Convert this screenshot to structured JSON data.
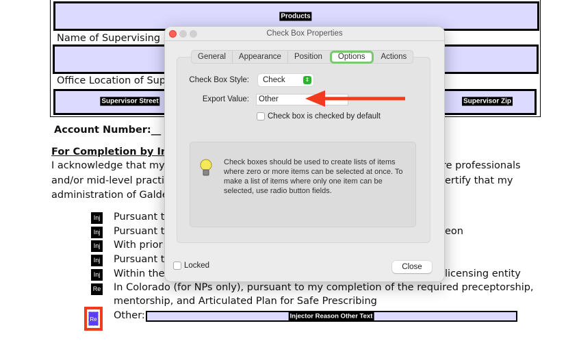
{
  "document": {
    "fields": {
      "products": "Products",
      "supervisor_street": "Supervisor Street",
      "supervisor_zip": "Supervisor Zip",
      "other_text": "Injector Reason Other Text"
    },
    "labels": {
      "supervising_name": "Name of Supervising He",
      "office_location": "Office Location of Supe",
      "account_number": "Account Number:__",
      "section_heading": "For Completion by Injec"
    },
    "paragraph": {
      "line1_left": "I acknowledge that my s",
      "line1_right": "re professionals",
      "line2_left": "and/or mid-level practit",
      "line2_right": "ertify that my",
      "line3_left": "administration of Galder"
    },
    "list": [
      {
        "icon": "Inj",
        "text": "Pursuant to",
        "right": ""
      },
      {
        "icon": "Inj",
        "text": "Pursuant to",
        "right": "eon"
      },
      {
        "icon": "Inj",
        "text": "With prior",
        "right": ""
      },
      {
        "icon": "Inj",
        "text": "Pursuant to",
        "right": ""
      },
      {
        "icon": "Inj",
        "text": "Within the",
        "right": "licensing entity"
      },
      {
        "icon": "Re",
        "text": "In Colorado (for NPs only), pursuant to my completion of the required preceptorship,",
        "right": ""
      }
    ],
    "list_continuation": "mentorship, and Articulated Plan for Safe Prescribing",
    "other_label": "Other:",
    "selected_checkbox_icon": "Re"
  },
  "dialog": {
    "title": "Check Box Properties",
    "tabs": [
      "General",
      "Appearance",
      "Position",
      "Options",
      "Actions"
    ],
    "active_tab": "Options",
    "style_label": "Check Box Style:",
    "style_value": "Check",
    "export_label": "Export Value:",
    "export_value": "Other",
    "default_checked_label": "Check box is checked by default",
    "default_checked": false,
    "info_text": "Check boxes should be used to create lists of items where zero or more items can be selected at once. To make a list of items where only one item can be selected, use radio button fields.",
    "locked_label": "Locked",
    "locked": false,
    "close_label": "Close"
  },
  "colors": {
    "field_fill": "#dcdaff",
    "annotation_arrow": "#f23a1e",
    "highlight_box": "#f23a1e",
    "active_tab_ring": "#7ac872",
    "stepper": "#2bb52b"
  }
}
